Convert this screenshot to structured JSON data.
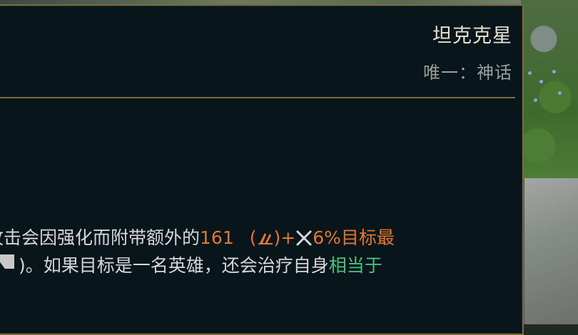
{
  "item": {
    "name": "坦克克星",
    "rarity": "唯一：神话"
  },
  "description": {
    "line1_prefix": "攻击会因强化而附带额外的",
    "line1_value": "161",
    "line1_plus": ")+",
    "line1_percent": "6%",
    "line1_suffix": "目标最",
    "line2_close": ")。",
    "line2_text": "如果目标是一名英雄，还会治疗自身",
    "line2_highlight": "相当于"
  },
  "colors": {
    "accent_orange": "#e2782c",
    "accent_green": "#49c07e",
    "border_gold": "#7a6a3e"
  },
  "icons": {
    "attack_damage": "attack-damage-icon",
    "crossed_swords": "crossed-swords-icon"
  }
}
